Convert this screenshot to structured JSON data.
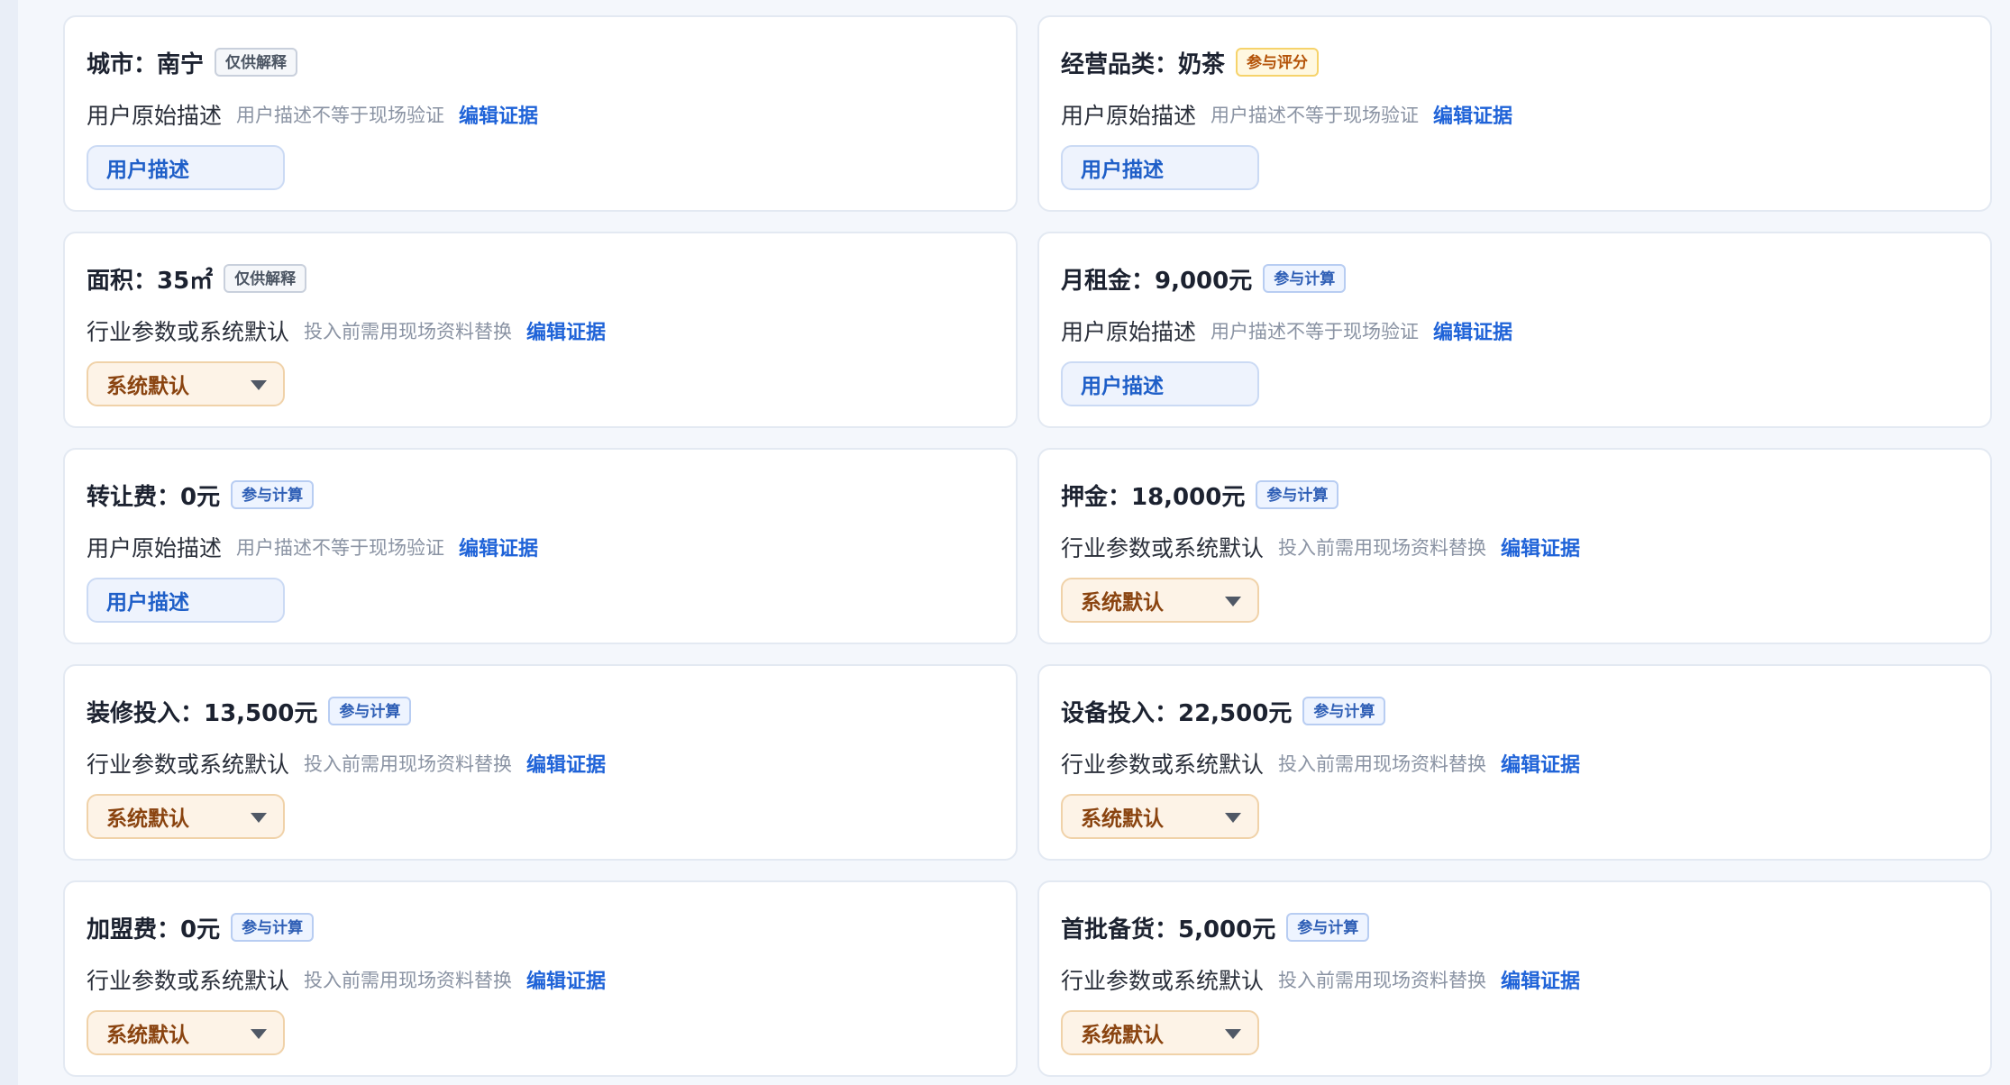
{
  "cards": [
    {
      "title": "城市：南宁",
      "tag": "仅供解释",
      "tag_kind": "gray",
      "source": "用户原始描述",
      "hint": "用户描述不等于现场验证",
      "edit": "编辑证据",
      "select": "用户描述",
      "select_kind": "user"
    },
    {
      "title": "经营品类：奶茶",
      "tag": "参与评分",
      "tag_kind": "yellow",
      "source": "用户原始描述",
      "hint": "用户描述不等于现场验证",
      "edit": "编辑证据",
      "select": "用户描述",
      "select_kind": "user"
    },
    {
      "title": "面积：35㎡",
      "tag": "仅供解释",
      "tag_kind": "gray",
      "source": "行业参数或系统默认",
      "hint": "投入前需用现场资料替换",
      "edit": "编辑证据",
      "select": "系统默认",
      "select_kind": "default"
    },
    {
      "title": "月租金：9,000元",
      "tag": "参与计算",
      "tag_kind": "blue",
      "source": "用户原始描述",
      "hint": "用户描述不等于现场验证",
      "edit": "编辑证据",
      "select": "用户描述",
      "select_kind": "user"
    },
    {
      "title": "转让费：0元",
      "tag": "参与计算",
      "tag_kind": "blue",
      "source": "用户原始描述",
      "hint": "用户描述不等于现场验证",
      "edit": "编辑证据",
      "select": "用户描述",
      "select_kind": "user"
    },
    {
      "title": "押金：18,000元",
      "tag": "参与计算",
      "tag_kind": "blue",
      "source": "行业参数或系统默认",
      "hint": "投入前需用现场资料替换",
      "edit": "编辑证据",
      "select": "系统默认",
      "select_kind": "default"
    },
    {
      "title": "装修投入：13,500元",
      "tag": "参与计算",
      "tag_kind": "blue",
      "source": "行业参数或系统默认",
      "hint": "投入前需用现场资料替换",
      "edit": "编辑证据",
      "select": "系统默认",
      "select_kind": "default"
    },
    {
      "title": "设备投入：22,500元",
      "tag": "参与计算",
      "tag_kind": "blue",
      "source": "行业参数或系统默认",
      "hint": "投入前需用现场资料替换",
      "edit": "编辑证据",
      "select": "系统默认",
      "select_kind": "default"
    },
    {
      "title": "加盟费：0元",
      "tag": "参与计算",
      "tag_kind": "blue",
      "source": "行业参数或系统默认",
      "hint": "投入前需用现场资料替换",
      "edit": "编辑证据",
      "select": "系统默认",
      "select_kind": "default"
    },
    {
      "title": "首批备货：5,000元",
      "tag": "参与计算",
      "tag_kind": "blue",
      "source": "行业参数或系统默认",
      "hint": "投入前需用现场资料替换",
      "edit": "编辑证据",
      "select": "系统默认",
      "select_kind": "default"
    }
  ],
  "colors": {
    "accent_link": "#1f63d8",
    "tag_gray": "#4b5563",
    "tag_yellow": "#b45309",
    "tag_blue": "#2f5fb6",
    "select_user": "#1f5fc8",
    "select_default": "#8a4410"
  },
  "icons": {
    "dropdown": "caret-down-icon"
  }
}
